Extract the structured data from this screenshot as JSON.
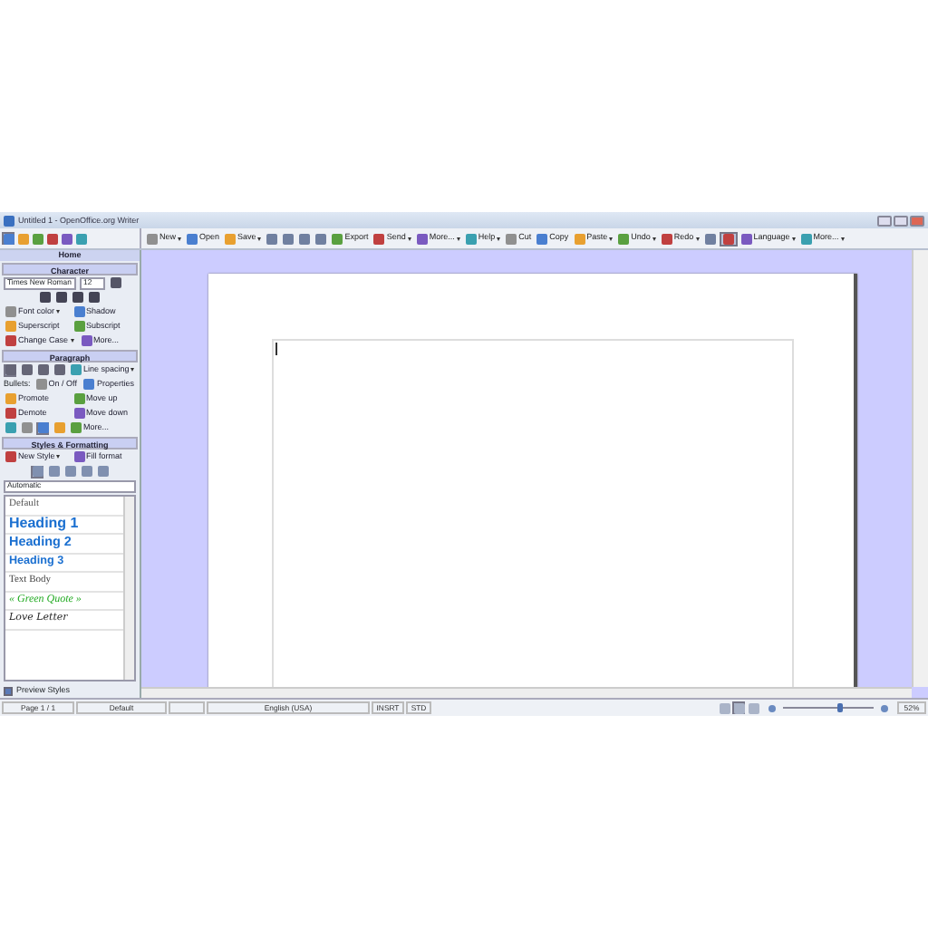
{
  "window": {
    "title": "Untitled 1 - OpenOffice.org Writer"
  },
  "toolbar": [
    {
      "kind": "button",
      "label": "New",
      "dropdown": true
    },
    {
      "kind": "button",
      "label": "Open",
      "dropdown": false
    },
    {
      "kind": "button",
      "label": "Save",
      "dropdown": true
    },
    {
      "kind": "icon"
    },
    {
      "kind": "icon"
    },
    {
      "kind": "icon"
    },
    {
      "kind": "icon"
    },
    {
      "kind": "button",
      "label": "Export",
      "dropdown": false
    },
    {
      "kind": "button",
      "label": "Send",
      "dropdown": true
    },
    {
      "kind": "button",
      "label": "More...",
      "dropdown": true
    },
    {
      "kind": "button",
      "label": "Help",
      "dropdown": true
    },
    {
      "kind": "button",
      "label": "Cut",
      "dropdown": false
    },
    {
      "kind": "button",
      "label": "Copy",
      "dropdown": false
    },
    {
      "kind": "button",
      "label": "Paste",
      "dropdown": true
    },
    {
      "kind": "button",
      "label": "Undo",
      "dropdown": true
    },
    {
      "kind": "button",
      "label": "Redo",
      "dropdown": true
    },
    {
      "kind": "icon"
    },
    {
      "kind": "toggle",
      "selected": true
    },
    {
      "kind": "button",
      "label": "Language",
      "dropdown": true
    },
    {
      "kind": "button",
      "label": "More...",
      "dropdown": true
    }
  ],
  "sidebar": {
    "deck_title": "Home",
    "character": {
      "title": "Character",
      "font_name": "Times New Roman",
      "font_size": "12",
      "rows": [
        [
          {
            "label": "Font color",
            "dropdown": true
          },
          {
            "label": "Shadow",
            "dropdown": false
          }
        ],
        [
          {
            "label": "Superscript",
            "dropdown": false
          },
          {
            "label": "Subscript",
            "dropdown": false
          }
        ],
        [
          {
            "label": "Change Case",
            "dropdown": true
          },
          {
            "label": "More...",
            "dropdown": false
          }
        ]
      ]
    },
    "paragraph": {
      "title": "Paragraph",
      "alignment": [
        {
          "selected": true
        },
        {
          "selected": false
        },
        {
          "selected": false
        },
        {
          "selected": false
        }
      ],
      "line_spacing": "Line spacing",
      "bullets_label": "Bullets:",
      "rows": [
        [
          {
            "label": "On / Off",
            "dropdown": false
          },
          {
            "label": "Properties",
            "dropdown": false
          }
        ],
        [
          {
            "label": "Promote",
            "dropdown": false
          },
          {
            "label": "Move up",
            "dropdown": false
          }
        ],
        [
          {
            "label": "Demote",
            "dropdown": false
          },
          {
            "label": "Move down",
            "dropdown": false
          }
        ]
      ],
      "tools": [
        {
          "selected": false
        },
        {
          "selected": false
        },
        {
          "selected": true
        },
        {
          "selected": false
        }
      ],
      "more": "More..."
    },
    "styles": {
      "title": "Styles & Formatting",
      "new_style": "New Style",
      "fill_format": "Fill format",
      "filters": [
        {
          "selected": true
        },
        {
          "selected": false
        },
        {
          "selected": false
        },
        {
          "selected": false
        },
        {
          "selected": false
        }
      ],
      "category": "Automatic",
      "items": [
        {
          "kind": "default",
          "label": "Default"
        },
        {
          "kind": "heading1",
          "label": "Heading 1"
        },
        {
          "kind": "heading2",
          "label": "Heading 2"
        },
        {
          "kind": "heading3",
          "label": "Heading 3"
        },
        {
          "kind": "body",
          "label": "Text Body"
        },
        {
          "kind": "quote",
          "label": "« Green Quote »"
        },
        {
          "kind": "script",
          "label": "Love Letter"
        }
      ],
      "preview_styles": {
        "label": "Preview Styles",
        "checked": true
      }
    }
  },
  "status_bar": {
    "page": "Page 1 / 1",
    "page_style": "Default",
    "language": "English (USA)",
    "insert_mode": "INSRT",
    "selection_mode": "STD",
    "views": [
      {
        "selected": false
      },
      {
        "selected": true
      },
      {
        "selected": false
      }
    ],
    "zoom": {
      "level": 0.6,
      "reading": "52%"
    }
  }
}
